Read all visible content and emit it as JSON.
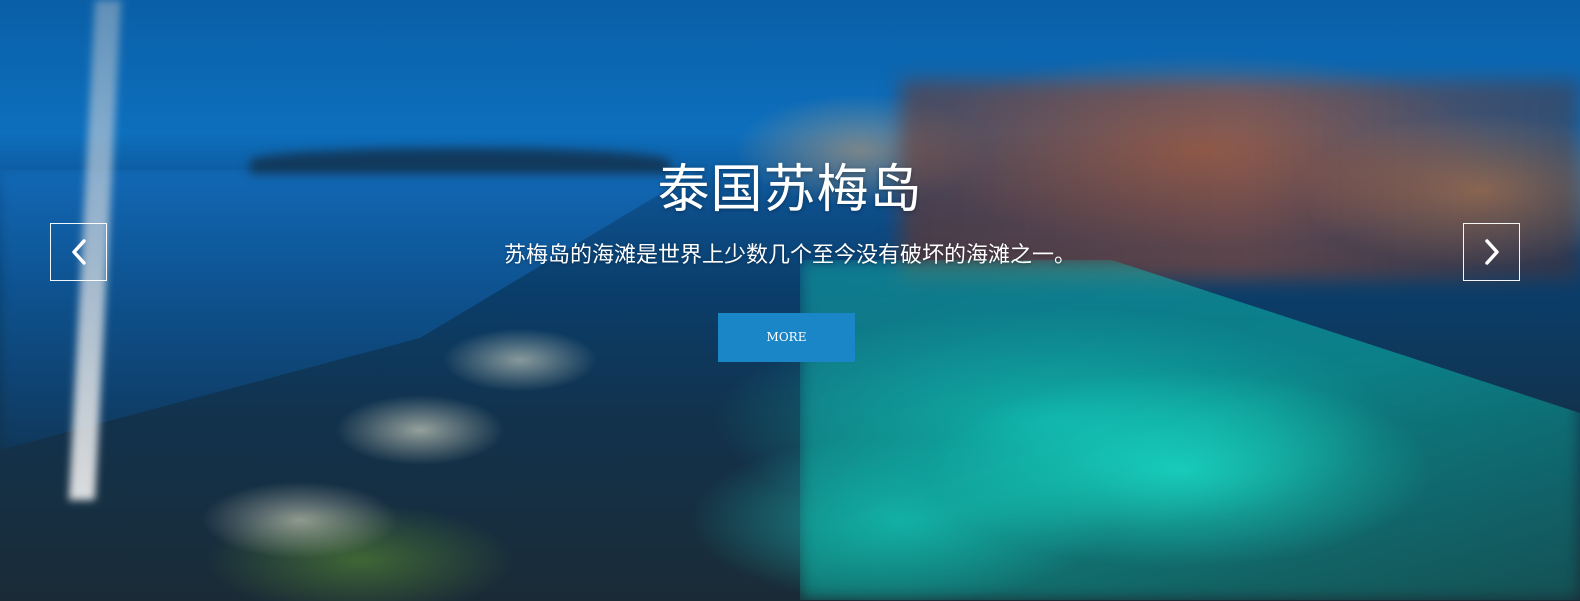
{
  "slide": {
    "title": "泰国苏梅岛",
    "subtitle": "苏梅岛的海滩是世界上少数几个至今没有破坏的海滩之一。",
    "more_label": "MORE"
  },
  "controls": {
    "prev_icon": "chevron-left-icon",
    "next_icon": "chevron-right-icon"
  },
  "colors": {
    "button_bg": "#1a86c8",
    "text": "#ffffff"
  }
}
